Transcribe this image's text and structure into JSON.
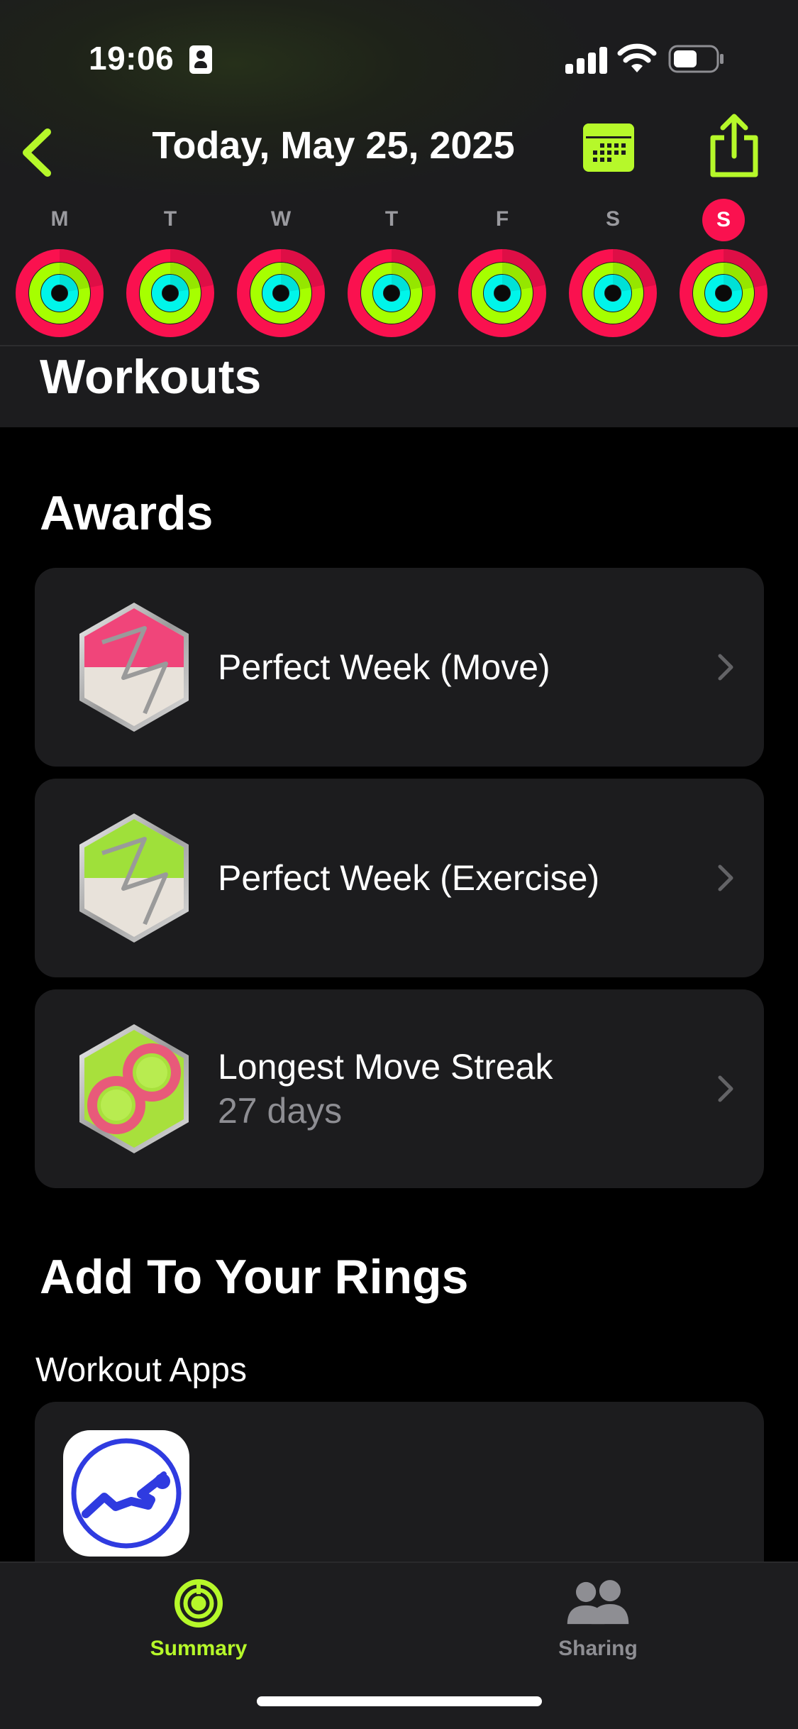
{
  "status_bar": {
    "time": "19:06"
  },
  "nav": {
    "title": "Today, May 25, 2025"
  },
  "week": {
    "days": [
      {
        "letter": "M",
        "today": false
      },
      {
        "letter": "T",
        "today": false
      },
      {
        "letter": "W",
        "today": false
      },
      {
        "letter": "T",
        "today": false
      },
      {
        "letter": "F",
        "today": false
      },
      {
        "letter": "S",
        "today": false
      },
      {
        "letter": "S",
        "today": true
      }
    ]
  },
  "sections": {
    "workouts": "Workouts",
    "awards": "Awards",
    "add_rings": "Add To Your Rings",
    "workout_apps": "Workout Apps"
  },
  "awards": [
    {
      "title": "Perfect Week (Move)",
      "subtitle": "",
      "badge": "perfect-week-move-badge-icon"
    },
    {
      "title": "Perfect Week (Exercise)",
      "subtitle": "",
      "badge": "perfect-week-exercise-badge-icon"
    },
    {
      "title": "Longest Move Streak",
      "subtitle": "27 days",
      "badge": "longest-move-streak-badge-icon"
    }
  ],
  "tabs": [
    {
      "label": "Summary",
      "active": true,
      "icon": "summary-rings-icon"
    },
    {
      "label": "Sharing",
      "active": false,
      "icon": "sharing-people-icon"
    }
  ],
  "colors": {
    "accent": "#b6f82a",
    "move": "#fa114f",
    "exercise": "#a6ff00",
    "stand": "#00f5ea",
    "card": "#1c1c1e",
    "secondary_text": "#8e8e93"
  }
}
